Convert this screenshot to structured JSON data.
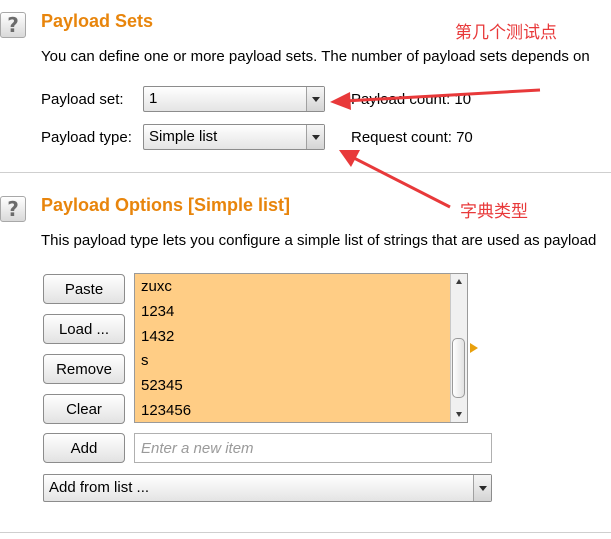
{
  "payload_sets": {
    "title": "Payload Sets",
    "description": "You can define one or more payload sets. The number of payload sets depends on",
    "payload_set_label": "Payload set:",
    "payload_set_value": "1",
    "payload_count_label": "Payload count:",
    "payload_count_value": "10",
    "payload_type_label": "Payload type:",
    "payload_type_value": "Simple list",
    "request_count_label": "Request count:",
    "request_count_value": "70"
  },
  "payload_options": {
    "title": "Payload Options [Simple list]",
    "description": "This payload type lets you configure a simple list of strings that are used as payload",
    "buttons": {
      "paste": "Paste",
      "load": "Load ...",
      "remove": "Remove",
      "clear": "Clear",
      "add": "Add"
    },
    "list_items": [
      "zuxc",
      "1234",
      "1432",
      "s",
      "52345",
      "123456"
    ],
    "new_item_placeholder": "Enter a new item",
    "add_from_list": "Add from list ..."
  },
  "annotations": {
    "test_point": "第几个测试点",
    "dictionary_type": "字典类型"
  },
  "colors": {
    "section_title": "#e8850c",
    "list_background": "#ffcd85",
    "annotation": "#e8393a"
  }
}
